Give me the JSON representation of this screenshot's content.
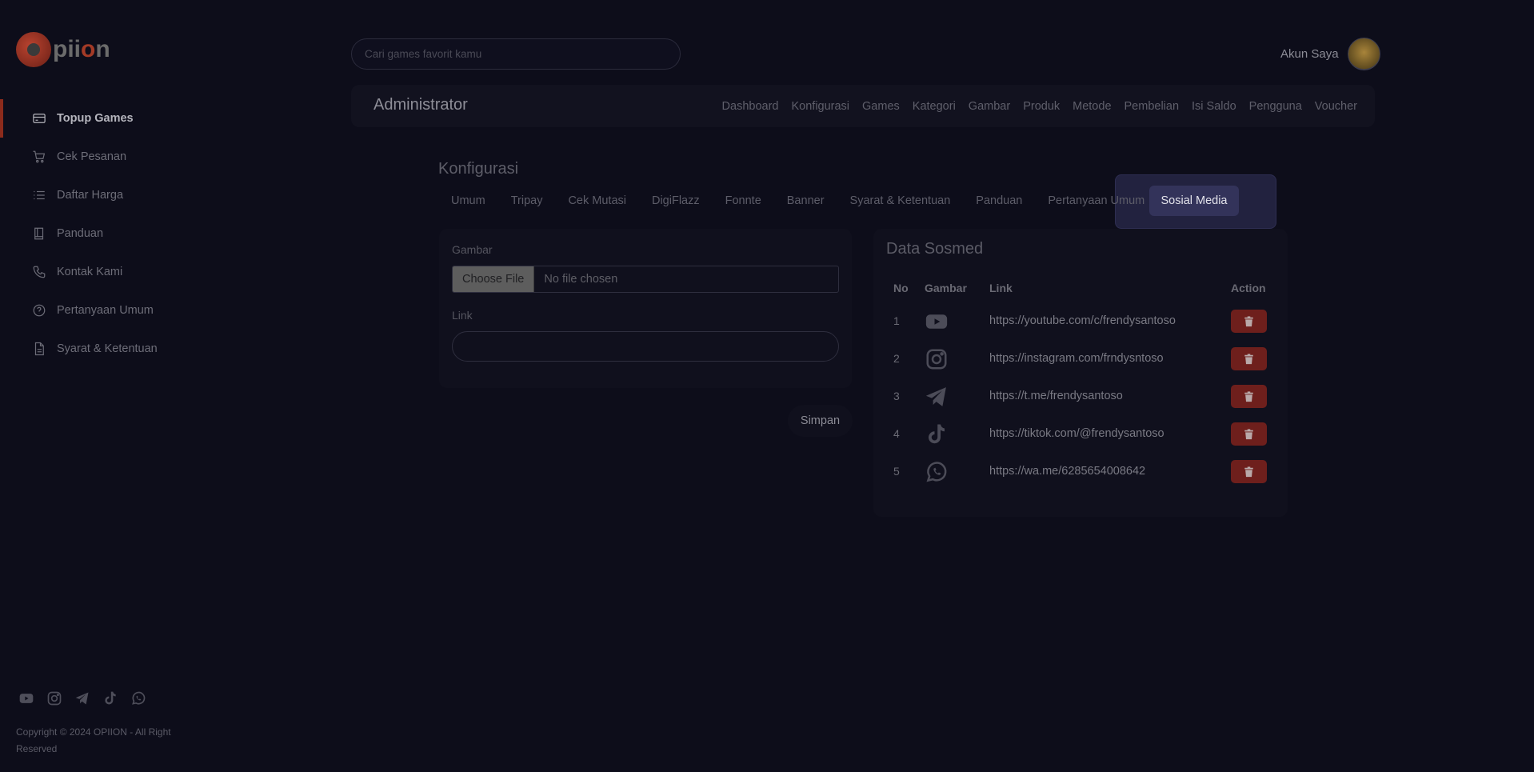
{
  "brand": {
    "logo_text_a": "pii",
    "logo_text_o": "o",
    "logo_text_b": "n"
  },
  "sidebar": {
    "items": [
      {
        "label": "Topup Games",
        "icon": "card-icon",
        "active": true
      },
      {
        "label": "Cek Pesanan",
        "icon": "cart-icon"
      },
      {
        "label": "Daftar Harga",
        "icon": "list-icon"
      },
      {
        "label": "Panduan",
        "icon": "book-icon"
      },
      {
        "label": "Kontak Kami",
        "icon": "phone-icon"
      },
      {
        "label": "Pertanyaan Umum",
        "icon": "help-icon"
      },
      {
        "label": "Syarat & Ketentuan",
        "icon": "document-icon"
      }
    ],
    "social_icons": [
      "youtube-icon",
      "instagram-icon",
      "telegram-icon",
      "tiktok-icon",
      "whatsapp-icon"
    ],
    "copyright": "Copyright © 2024 OPIION - All Right Reserved"
  },
  "header": {
    "search_placeholder": "Cari games favorit kamu",
    "account_label": "Akun Saya"
  },
  "admin": {
    "title": "Administrator",
    "links": [
      "Dashboard",
      "Konfigurasi",
      "Games",
      "Kategori",
      "Gambar",
      "Produk",
      "Metode",
      "Pembelian",
      "Isi Saldo",
      "Pengguna",
      "Voucher"
    ]
  },
  "config": {
    "title": "Konfigurasi",
    "tabs": [
      "Umum",
      "Tripay",
      "Cek Mutasi",
      "DigiFlazz",
      "Fonnte",
      "Banner",
      "Syarat & Ketentuan",
      "Panduan",
      "Pertanyaan Umum"
    ],
    "active_tab": "Sosial Media"
  },
  "form": {
    "image_label": "Gambar",
    "file_button": "Choose File",
    "file_status": "No file chosen",
    "link_label": "Link",
    "link_value": "",
    "save_label": "Simpan"
  },
  "sosmed": {
    "title": "Data Sosmed",
    "headers": {
      "no": "No",
      "image": "Gambar",
      "link": "Link",
      "action": "Action"
    },
    "rows": [
      {
        "no": "1",
        "icon": "youtube-icon",
        "link": "https://youtube.com/c/frendysantoso"
      },
      {
        "no": "2",
        "icon": "instagram-icon",
        "link": "https://instagram.com/frndysntoso"
      },
      {
        "no": "3",
        "icon": "telegram-icon",
        "link": "https://t.me/frendysantoso"
      },
      {
        "no": "4",
        "icon": "tiktok-icon",
        "link": "https://tiktok.com/@frendysantoso"
      },
      {
        "no": "5",
        "icon": "whatsapp-icon",
        "link": "https://wa.me/6285654008642"
      }
    ]
  },
  "colors": {
    "background": "#0d0d1a",
    "accent_red": "#8c2b1c",
    "delete_button": "#6e1f1c",
    "active_tab": "#33335a"
  }
}
